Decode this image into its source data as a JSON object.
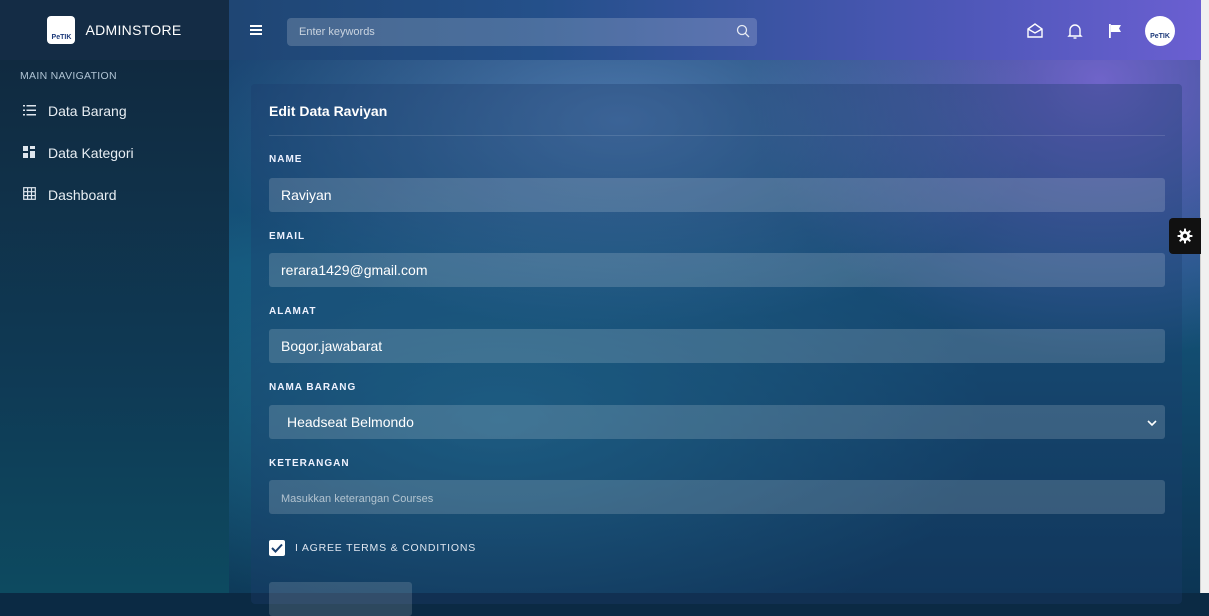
{
  "brand": {
    "name": "ADMINSTORE",
    "logo_text": "PeTIK"
  },
  "search": {
    "placeholder": "Enter keywords"
  },
  "header_avatar_text": "PeTIK",
  "sidebar": {
    "section_title": "MAIN NAVIGATION",
    "items": [
      {
        "label": "Data Barang",
        "icon": "list-icon"
      },
      {
        "label": "Data Kategori",
        "icon": "grid-icon"
      },
      {
        "label": "Dashboard",
        "icon": "table-icon"
      }
    ]
  },
  "form": {
    "title": "Edit Data Raviyan",
    "name_label": "NAME",
    "name_value": "Raviyan",
    "email_label": "EMAIL",
    "email_value": "rerara1429@gmail.com",
    "alamat_label": "ALAMAT",
    "alamat_value": "Bogor.jawabarat",
    "nama_barang_label": "NAMA BARANG",
    "nama_barang_value": "Headseat Belmondo",
    "keterangan_label": "KETERANGAN",
    "keterangan_placeholder": "Masukkan keterangan Courses",
    "agree_label": "I AGREE TERMS & CONDITIONS"
  },
  "colors": {
    "sidebar_bg": "#102a40",
    "accent": "#6a5fd1"
  }
}
